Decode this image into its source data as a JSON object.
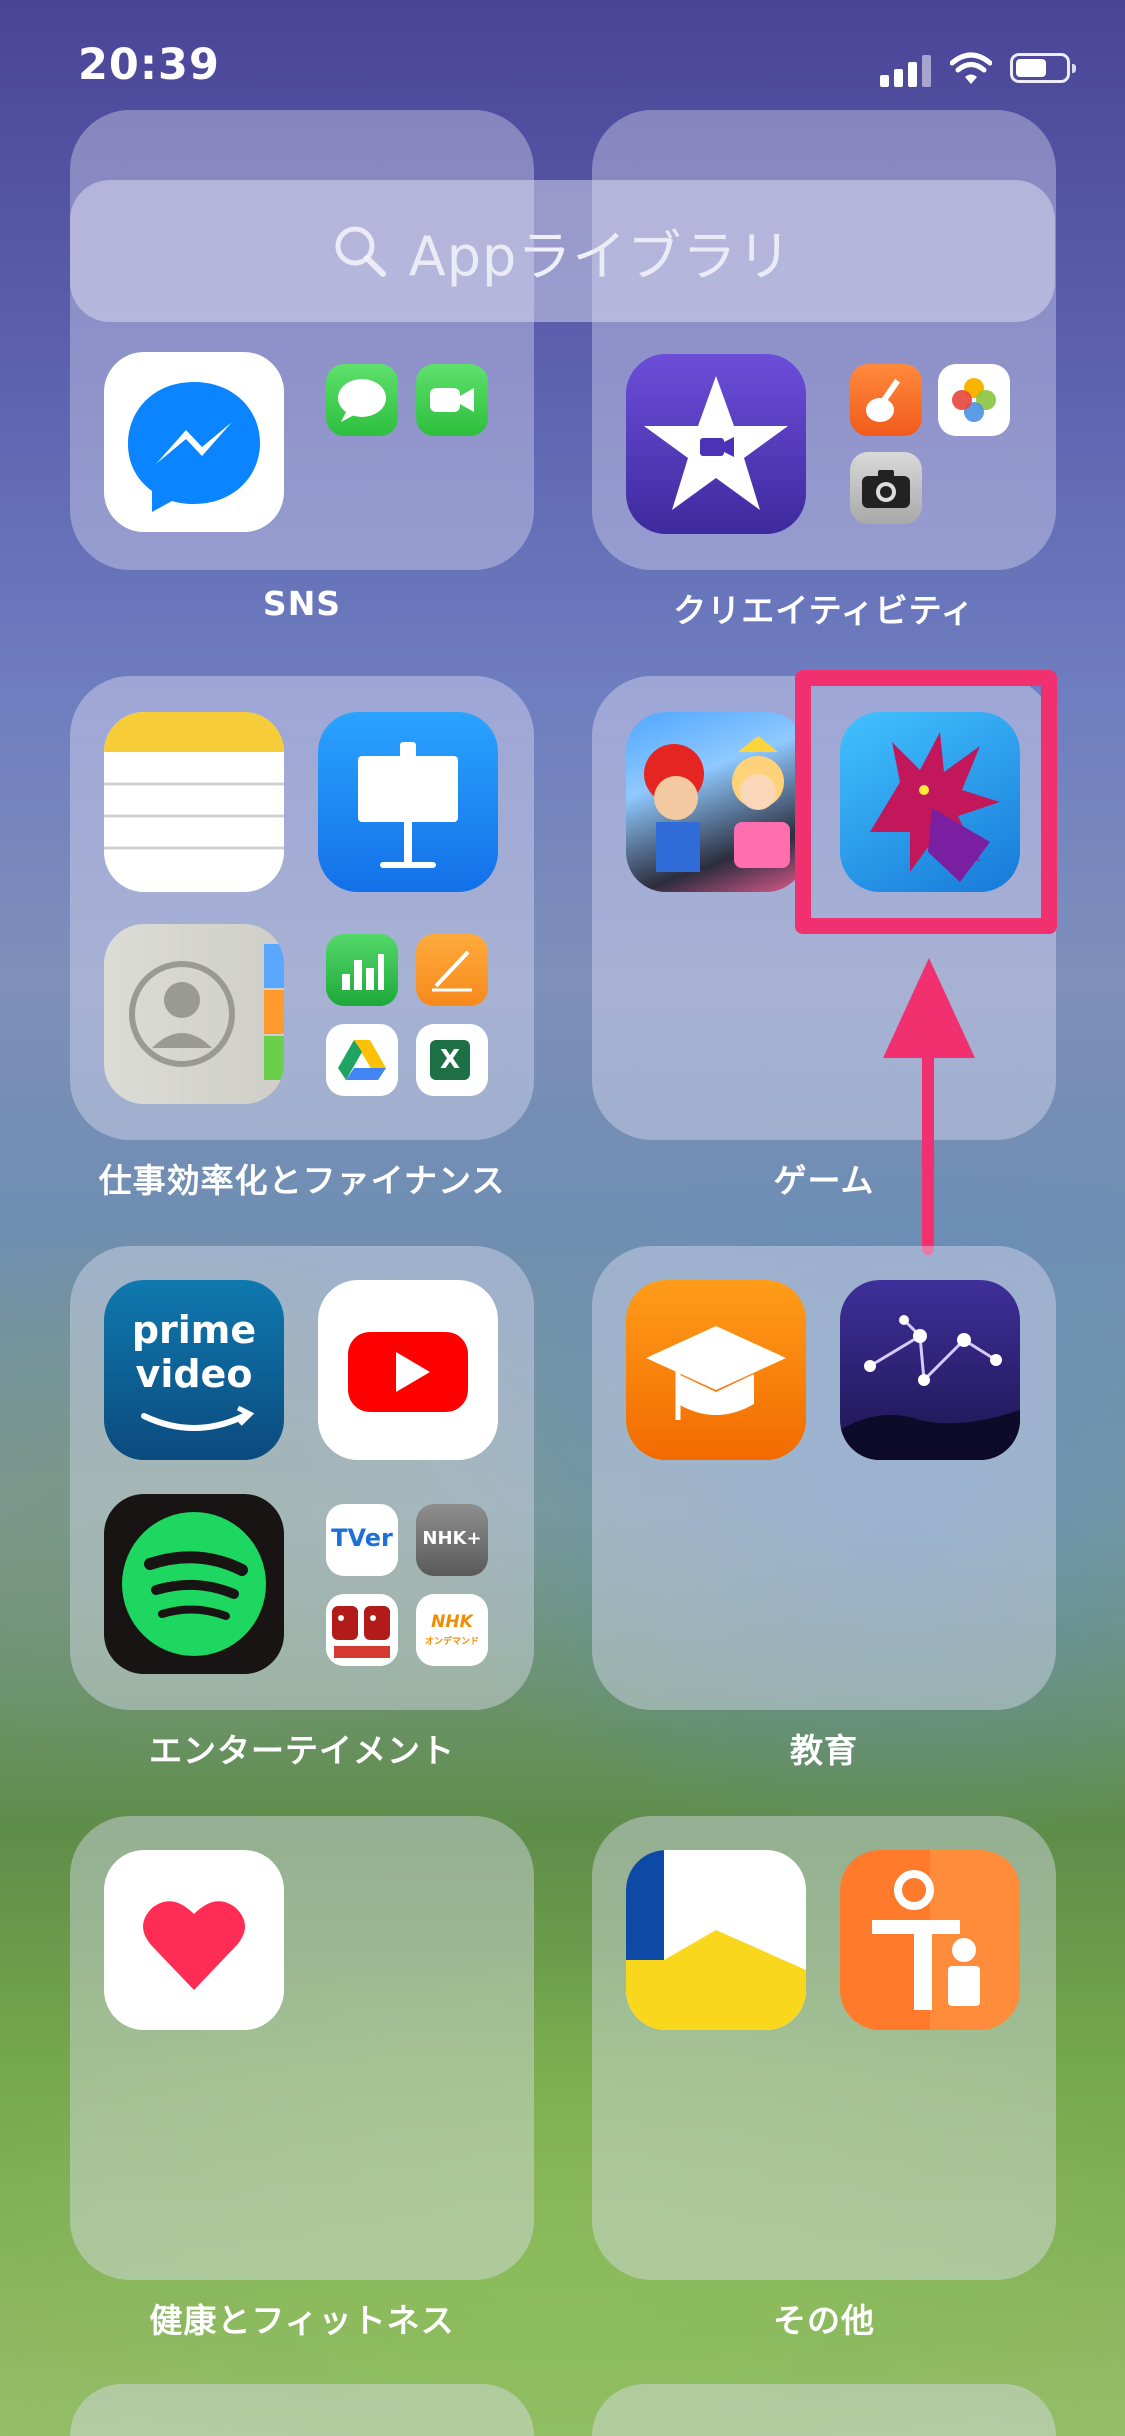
{
  "status_bar": {
    "time": "20:39"
  },
  "search": {
    "placeholder": "Appライブラリ"
  },
  "folders": [
    {
      "title": "SNS",
      "apps": [
        "Messenger",
        "Messages",
        "FaceTime"
      ]
    },
    {
      "title": "クリエイティビティ",
      "apps": [
        "iMovie",
        "GarageBand",
        "Photos",
        "Camera"
      ]
    },
    {
      "title": "仕事効率化とファイナンス",
      "apps": [
        "Notes",
        "Keynote",
        "Contacts",
        "Numbers",
        "Pages",
        "Google Drive",
        "Excel"
      ]
    },
    {
      "title": "ゲーム",
      "apps": [
        "Mario Kart Tour",
        "Puzzle & Dragons"
      ]
    },
    {
      "title": "エンターテイメント",
      "apps": [
        "Prime Video",
        "YouTube",
        "Spotify",
        "TVer",
        "NHK+",
        "紅白歌合戦",
        "NHKオンデマンド"
      ]
    },
    {
      "title": "教育",
      "apps": [
        "iTunes U",
        "Star Walk"
      ]
    },
    {
      "title": "健康とフィットネス",
      "apps": [
        "Health"
      ]
    },
    {
      "title": "その他",
      "apps": [
        "Unknown app",
        "Screen Time"
      ]
    }
  ],
  "icons_text": {
    "prime_line1": "prime",
    "prime_line2": "video",
    "tver": "TVer",
    "nhkplus": "NHK+",
    "nhk_od_top": "NHK",
    "nhk_od_bottom": "オンデマンド",
    "excel": "X"
  },
  "annotation": {
    "highlight_color": "#f0306f"
  }
}
